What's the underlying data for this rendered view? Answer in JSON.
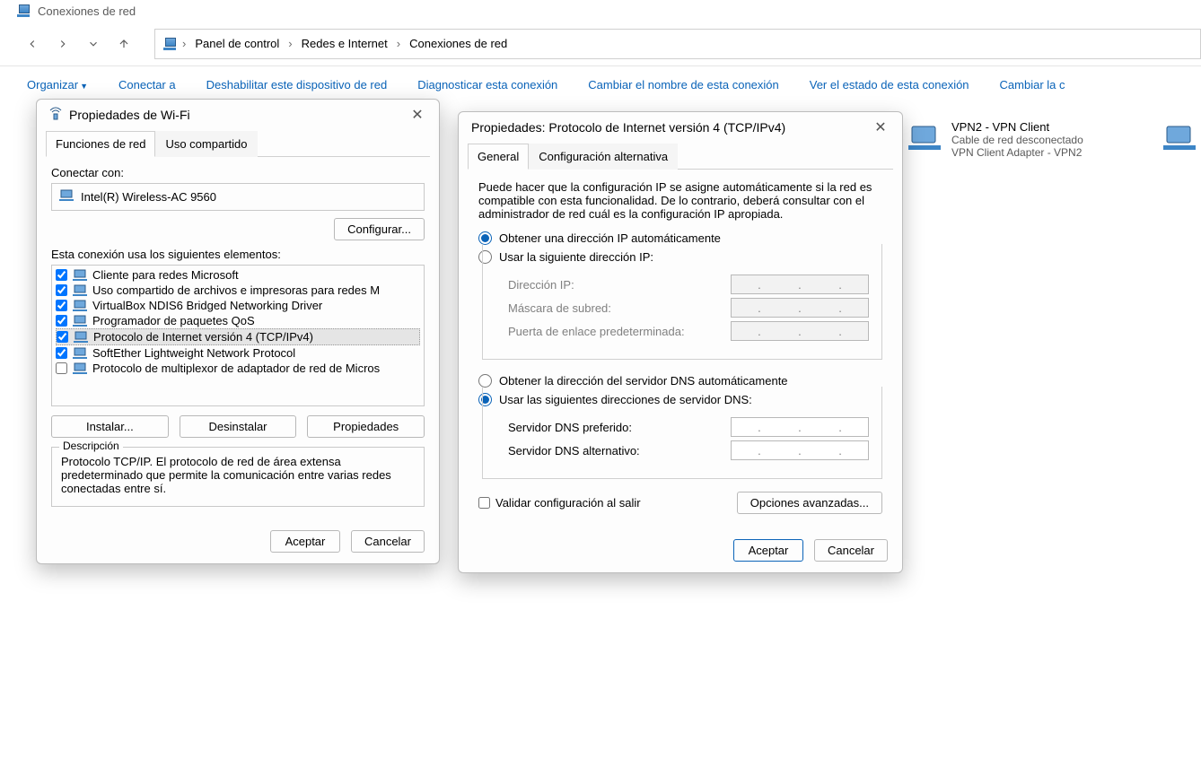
{
  "window_title": "Conexiones de red",
  "breadcrumbs": [
    "Panel de control",
    "Redes e Internet",
    "Conexiones de red"
  ],
  "command_bar": {
    "organize": "Organizar",
    "connect_to": "Conectar a",
    "disable": "Deshabilitar este dispositivo de red",
    "diagnose": "Diagnosticar esta conexión",
    "rename": "Cambiar el nombre de esta conexión",
    "view_status": "Ver el estado de esta conexión",
    "change": "Cambiar la c"
  },
  "adapter_vpn2": {
    "title": "VPN2 - VPN Client",
    "line2": "Cable de red desconectado",
    "line3": "VPN Client Adapter - VPN2"
  },
  "wifi_dialog": {
    "title": "Propiedades de Wi-Fi",
    "tab_networking": "Funciones de red",
    "tab_sharing": "Uso compartido",
    "connect_using_label": "Conectar con:",
    "adapter_name": "Intel(R) Wireless-AC 9560",
    "configure_btn": "Configurar...",
    "uses_components_label": "Esta conexión usa los siguientes elementos:",
    "components": [
      {
        "checked": true,
        "label": "Cliente para redes Microsoft"
      },
      {
        "checked": true,
        "label": "Uso compartido de archivos e impresoras para redes M"
      },
      {
        "checked": true,
        "label": "VirtualBox NDIS6 Bridged Networking Driver"
      },
      {
        "checked": true,
        "label": "Programador de paquetes QoS"
      },
      {
        "checked": true,
        "label": "Protocolo de Internet versión 4 (TCP/IPv4)",
        "selected": true
      },
      {
        "checked": true,
        "label": "SoftEther Lightweight Network Protocol"
      },
      {
        "checked": false,
        "label": "Protocolo de multiplexor de adaptador de red de Micros"
      }
    ],
    "install_btn": "Instalar...",
    "uninstall_btn": "Desinstalar",
    "properties_btn": "Propiedades",
    "description_label": "Descripción",
    "description_text": "Protocolo TCP/IP. El protocolo de red de área extensa predeterminado que permite la comunicación entre varias redes conectadas entre sí.",
    "accept_btn": "Aceptar",
    "cancel_btn": "Cancelar"
  },
  "ipv4_dialog": {
    "title": "Propiedades: Protocolo de Internet versión 4 (TCP/IPv4)",
    "tab_general": "General",
    "tab_alt": "Configuración alternativa",
    "intro_text": "Puede hacer que la configuración IP se asigne automáticamente si la red es compatible con esta funcionalidad. De lo contrario, deberá consultar con el administrador de red cuál es la configuración IP apropiada.",
    "ip_auto": "Obtener una dirección IP automáticamente",
    "ip_manual": "Usar la siguiente dirección IP:",
    "ip_address_label": "Dirección IP:",
    "subnet_label": "Máscara de subred:",
    "gateway_label": "Puerta de enlace predeterminada:",
    "dns_auto": "Obtener la dirección del servidor DNS automáticamente",
    "dns_manual": "Usar las siguientes direcciones de servidor DNS:",
    "dns_pref_label": "Servidor DNS preferido:",
    "dns_alt_label": "Servidor DNS alternativo:",
    "validate_label": "Validar configuración al salir",
    "advanced_btn": "Opciones avanzadas...",
    "accept_btn": "Aceptar",
    "cancel_btn": "Cancelar"
  }
}
